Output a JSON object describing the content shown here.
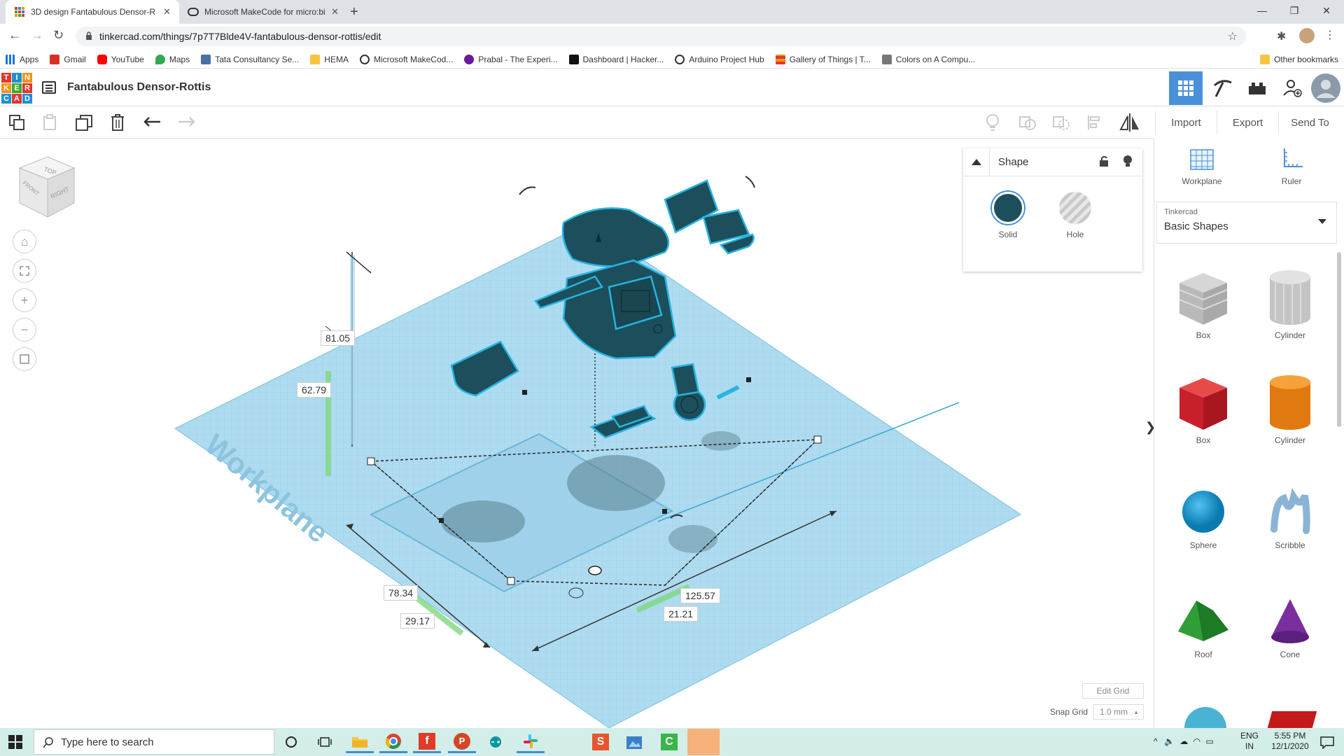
{
  "browser": {
    "tabs": [
      {
        "title": "3D design Fantabulous Densor-R",
        "active": true
      },
      {
        "title": "Microsoft MakeCode for micro:bi",
        "active": false
      }
    ],
    "url": "tinkercad.com/things/7p7T7Blde4V-fantabulous-densor-rottis/edit",
    "bookmarks": [
      "Apps",
      "Gmail",
      "YouTube",
      "Maps",
      "Tata Consultancy Se...",
      "HEMA",
      "Microsoft MakeCod...",
      "Prabal - The Experi...",
      "Dashboard | Hacker...",
      "Arduino Project Hub",
      "Gallery of Things | T...",
      "Colors on A Compu..."
    ],
    "other_bookmarks": "Other bookmarks"
  },
  "app": {
    "logo": [
      "T",
      "I",
      "N",
      "K",
      "E",
      "R",
      "C",
      "A",
      "D"
    ],
    "title": "Fantabulous Densor-Rottis"
  },
  "toolbar": {
    "import_label": "Import",
    "export_label": "Export",
    "send_to_label": "Send To"
  },
  "viewcube": {
    "top": "TOP",
    "front": "FRONT",
    "right": "RIGHT"
  },
  "canvas": {
    "workplane_label": "Workplane",
    "dimensions": {
      "height_total": "81.05",
      "height_offset": "62.79",
      "depth": "78.34",
      "depth_offset": "29.17",
      "width": "125.57",
      "width_offset": "21.21"
    }
  },
  "shape_panel": {
    "title": "Shape",
    "solid_label": "Solid",
    "hole_label": "Hole",
    "solid_color": "#1c4f5b"
  },
  "right_panel": {
    "workplane_label": "Workplane",
    "ruler_label": "Ruler",
    "library_small": "Tinkercad",
    "library_value": "Basic Shapes",
    "shapes": [
      {
        "label": "Box"
      },
      {
        "label": "Cylinder"
      },
      {
        "label": "Box"
      },
      {
        "label": "Cylinder"
      },
      {
        "label": "Sphere"
      },
      {
        "label": "Scribble"
      },
      {
        "label": "Roof"
      },
      {
        "label": "Cone"
      }
    ],
    "edit_grid": "Edit Grid",
    "snap_grid_label": "Snap Grid",
    "snap_grid_value": "1.0 mm"
  },
  "taskbar": {
    "search_placeholder": "Type here to search",
    "lang1": "ENG",
    "lang2": "IN",
    "time": "5:55 PM",
    "date": "12/1/2020"
  },
  "colors": {
    "accent": "#4a90d9",
    "workplane": "#a9d8ee",
    "model": "#1c4f5b",
    "taskbar": "#d3eee8"
  }
}
